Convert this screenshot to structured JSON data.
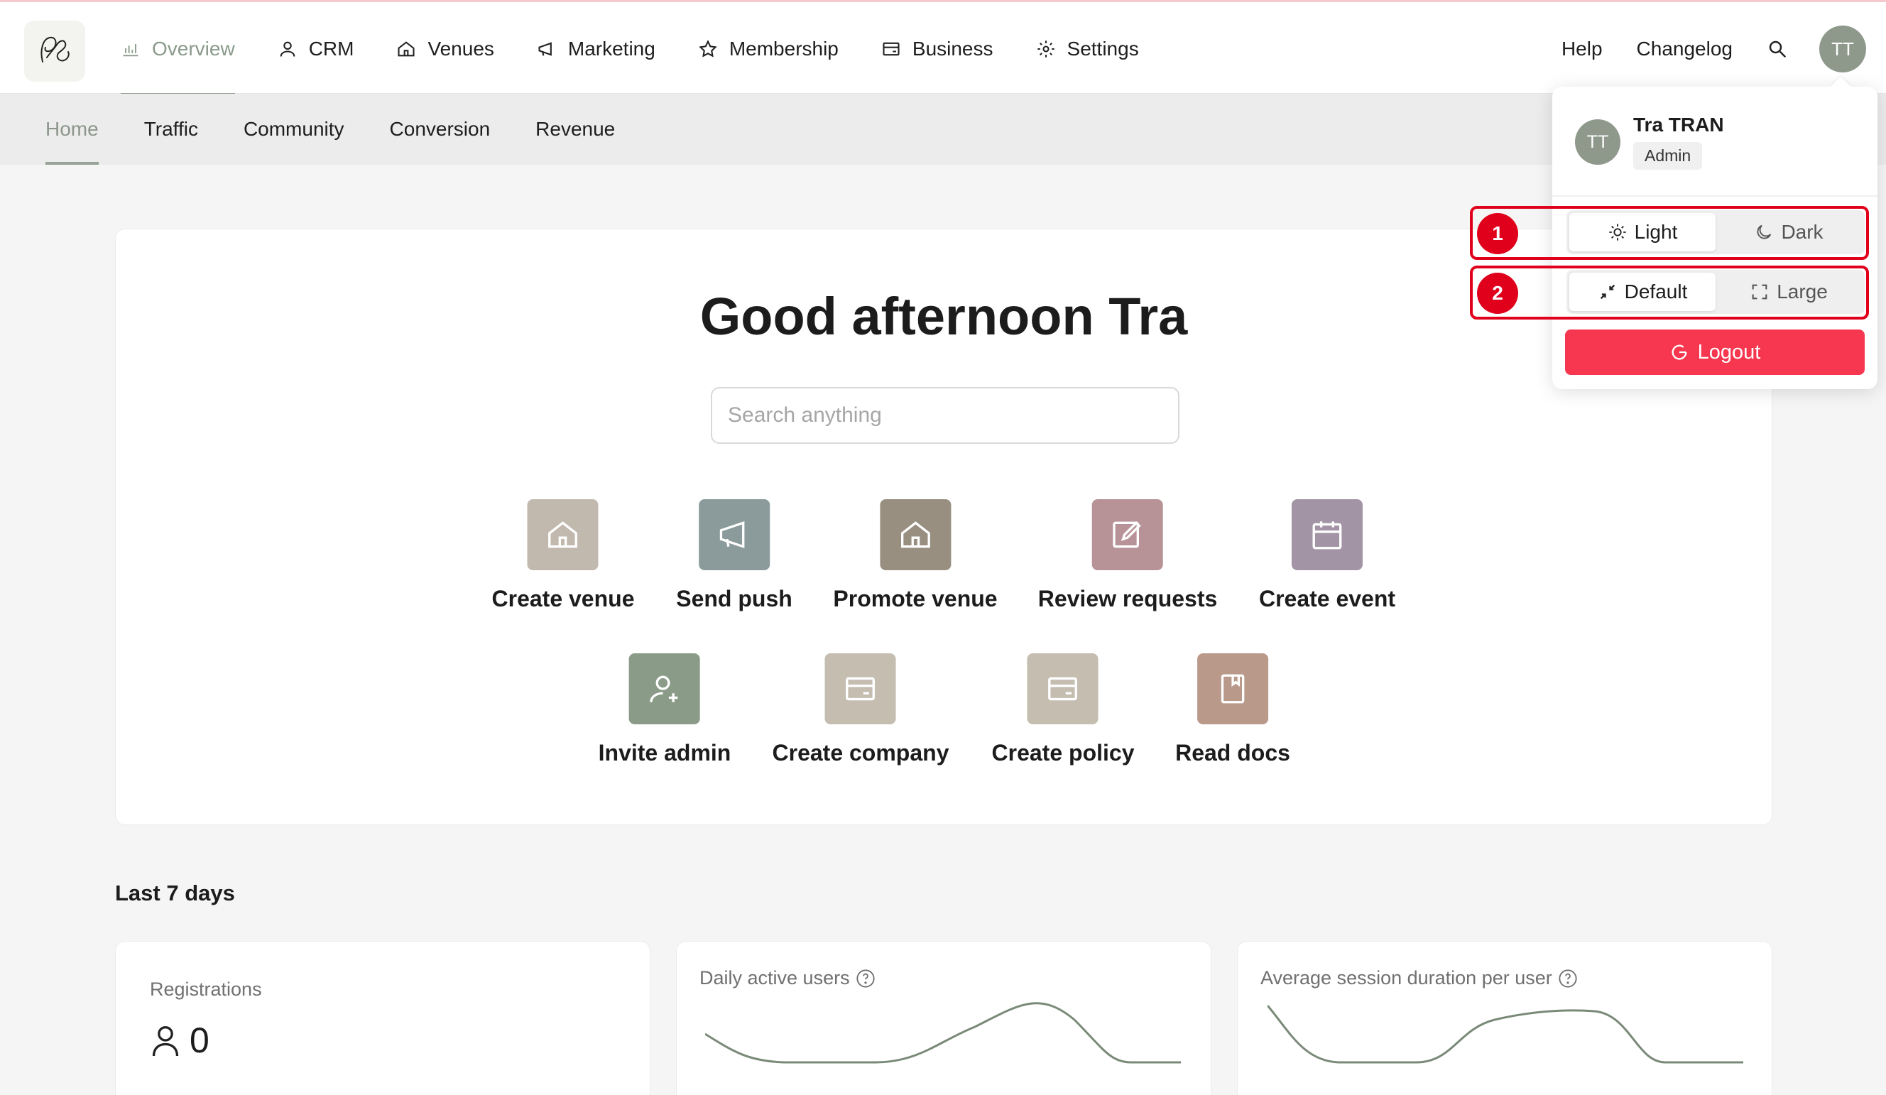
{
  "app": {
    "logo_icon": "signature-logo-icon"
  },
  "topnav": {
    "items": [
      {
        "label": "Overview",
        "icon": "bar-chart-icon",
        "active": true
      },
      {
        "label": "CRM",
        "icon": "user-icon"
      },
      {
        "label": "Venues",
        "icon": "home-icon"
      },
      {
        "label": "Marketing",
        "icon": "megaphone-icon"
      },
      {
        "label": "Membership",
        "icon": "star-icon"
      },
      {
        "label": "Business",
        "icon": "card-icon"
      },
      {
        "label": "Settings",
        "icon": "gear-icon"
      }
    ],
    "help": "Help",
    "changelog": "Changelog",
    "avatar_initials": "TT"
  },
  "subnav": {
    "tabs": [
      {
        "label": "Home",
        "active": true
      },
      {
        "label": "Traffic"
      },
      {
        "label": "Community"
      },
      {
        "label": "Conversion"
      },
      {
        "label": "Revenue"
      }
    ]
  },
  "hero": {
    "greeting": "Good afternoon Tra",
    "search_placeholder": "Search anything",
    "actions": [
      {
        "label": "Create venue",
        "icon": "home-icon",
        "color": "#c1b9ad"
      },
      {
        "label": "Send push",
        "icon": "megaphone-icon",
        "color": "#8b9a9a"
      },
      {
        "label": "Promote venue",
        "icon": "home-icon",
        "color": "#998f81"
      },
      {
        "label": "Review requests",
        "icon": "edit-icon",
        "color": "#b79398"
      },
      {
        "label": "Create event",
        "icon": "calendar-icon",
        "color": "#a294a4"
      },
      {
        "label": "Invite admin",
        "icon": "user-plus-icon",
        "color": "#8a9c88"
      },
      {
        "label": "Create company",
        "icon": "card-icon",
        "color": "#c4bdb0"
      },
      {
        "label": "Create policy",
        "icon": "card-icon",
        "color": "#c4bdb0"
      },
      {
        "label": "Read docs",
        "icon": "book-icon",
        "color": "#b99a8a"
      }
    ]
  },
  "stats": {
    "section_title": "Last 7 days",
    "cards": [
      {
        "title": "Registrations",
        "value": "0",
        "icon": "user-icon"
      },
      {
        "title": "Daily active users",
        "icon": "question-circle-icon"
      },
      {
        "title": "Average session duration per user",
        "icon": "question-circle-icon"
      }
    ]
  },
  "dropdown": {
    "avatar_initials": "TT",
    "name": "Tra TRAN",
    "role": "Admin",
    "theme": {
      "light": "Light",
      "dark": "Dark",
      "selected": "Light"
    },
    "size": {
      "default": "Default",
      "large": "Large",
      "selected": "Default"
    },
    "logout": "Logout"
  },
  "annotations": [
    "1",
    "2"
  ],
  "colors": {
    "accent": "#8d9b8c",
    "logout": "#f7374f",
    "annotation": "#e0001b"
  }
}
